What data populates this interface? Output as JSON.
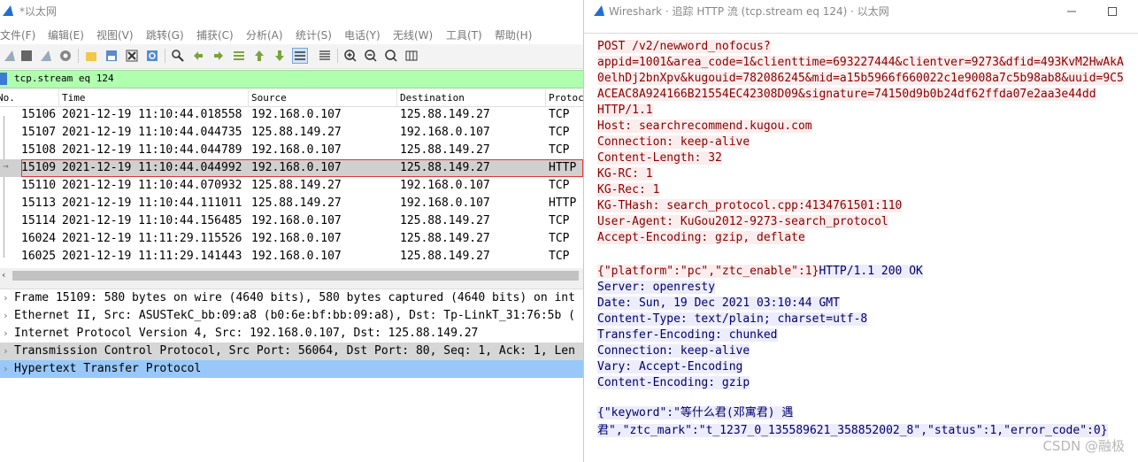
{
  "left_window": {
    "title": "*以太网",
    "menu": [
      "文件(F)",
      "编辑(E)",
      "视图(V)",
      "跳转(G)",
      "捕获(C)",
      "分析(A)",
      "统计(S)",
      "电话(Y)",
      "无线(W)",
      "工具(T)",
      "帮助(H)"
    ],
    "display_filter": "tcp.stream eq 124",
    "columns": [
      "No.",
      "Time",
      "Source",
      "Destination",
      "Protocol"
    ],
    "packets": [
      {
        "no": "15106",
        "time": "2021-12-19 11:10:44.018558",
        "src": "192.168.0.107",
        "dst": "125.88.149.27",
        "proto": "TCP"
      },
      {
        "no": "15107",
        "time": "2021-12-19 11:10:44.044735",
        "src": "125.88.149.27",
        "dst": "192.168.0.107",
        "proto": "TCP"
      },
      {
        "no": "15108",
        "time": "2021-12-19 11:10:44.044789",
        "src": "192.168.0.107",
        "dst": "125.88.149.27",
        "proto": "TCP"
      },
      {
        "no": "15109",
        "time": "2021-12-19 11:10:44.044992",
        "src": "192.168.0.107",
        "dst": "125.88.149.27",
        "proto": "HTTP"
      },
      {
        "no": "15110",
        "time": "2021-12-19 11:10:44.070932",
        "src": "125.88.149.27",
        "dst": "192.168.0.107",
        "proto": "TCP"
      },
      {
        "no": "15113",
        "time": "2021-12-19 11:10:44.111011",
        "src": "125.88.149.27",
        "dst": "192.168.0.107",
        "proto": "HTTP"
      },
      {
        "no": "15114",
        "time": "2021-12-19 11:10:44.156485",
        "src": "192.168.0.107",
        "dst": "125.88.149.27",
        "proto": "TCP"
      },
      {
        "no": "16024",
        "time": "2021-12-19 11:11:29.115526",
        "src": "192.168.0.107",
        "dst": "125.88.149.27",
        "proto": "TCP"
      },
      {
        "no": "16025",
        "time": "2021-12-19 11:11:29.141443",
        "src": "192.168.0.107",
        "dst": "125.88.149.27",
        "proto": "TCP"
      }
    ],
    "details": [
      "Frame 15109: 580 bytes on wire (4640 bits), 580 bytes captured (4640 bits) on int",
      "Ethernet II, Src: ASUSTekC_bb:09:a8 (b0:6e:bf:bb:09:a8), Dst: Tp-LinkT_31:76:5b (",
      "Internet Protocol Version 4, Src: 192.168.0.107, Dst: 125.88.149.27",
      "Transmission Control Protocol, Src Port: 56064, Dst Port: 80, Seq: 1, Ack: 1, Len",
      "Hypertext Transfer Protocol"
    ]
  },
  "right_window": {
    "title": "Wireshark · 追踪 HTTP 流 (tcp.stream eq 124) · 以太网",
    "request_lines": [
      "POST /v2/newword_nofocus?",
      "appid=1001&area_code=1&clienttime=693227444&clientver=9273&dfid=493KvM2HwAkA",
      "0elhDj2bnXpv&kugouid=782086245&mid=a15b5966f660022c1e9008a7c5b98ab8&uuid=9C5",
      "ACEAC8A924166B21554EC42308D09&signature=74150d9b0b24df62ffda07e2aa3e44dd",
      "HTTP/1.1",
      "Host: searchrecommend.kugou.com",
      "Connection: keep-alive",
      "Content-Length: 32",
      "KG-RC: 1",
      "KG-Rec: 1",
      "KG-THash: search_protocol.cpp:4134761501:110",
      "User-Agent: KuGou2012-9273-search_protocol",
      "Accept-Encoding: gzip, deflate"
    ],
    "request_body": "{\"platform\":\"pc\",\"ztc_enable\":1}",
    "response_status": "HTTP/1.1 200 OK",
    "response_lines": [
      "Server: openresty",
      "Date: Sun, 19 Dec 2021 03:10:44 GMT",
      "Content-Type: text/plain; charset=utf-8",
      "Transfer-Encoding: chunked",
      "Connection: keep-alive",
      "Vary: Accept-Encoding",
      "Content-Encoding: gzip"
    ],
    "response_body_1": "{\"keyword\":\"等什么君(邓寓君) 遇",
    "response_body_2": "君\",\"ztc_mark\":\"t_1237_0_135589621_358852002_8\",\"status\":1,\"error_code\":0}"
  },
  "watermark": "CSDN @融极"
}
